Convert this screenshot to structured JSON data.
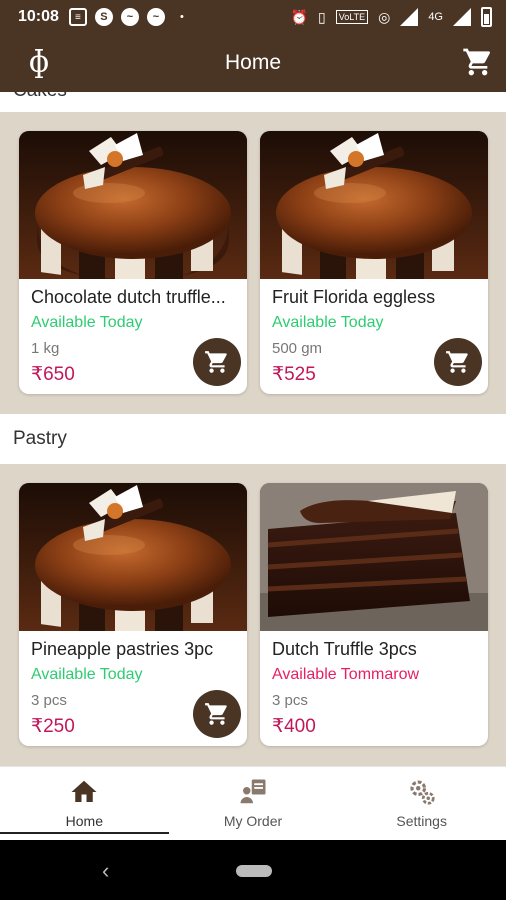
{
  "status_bar": {
    "time": "10:08",
    "network": "4G"
  },
  "app_bar": {
    "title": "Home",
    "logo_text": "ɸ"
  },
  "sections": [
    {
      "title": "Cakes",
      "items": [
        {
          "name": "Chocolate dutch truffle...",
          "availability": "Available Today",
          "quantity": "1 kg",
          "price": "₹650",
          "has_cart": true
        },
        {
          "name": "Fruit Florida eggless",
          "availability": "Available Today",
          "quantity": "500 gm",
          "price": "₹525",
          "has_cart": true
        }
      ]
    },
    {
      "title": "Pastry",
      "items": [
        {
          "name": "Pineapple pastries 3pc",
          "availability": "Available Today",
          "quantity": "3 pcs",
          "price": "₹250",
          "has_cart": true
        },
        {
          "name": "Dutch Truffle 3pcs",
          "availability": "Available Tommarow",
          "quantity": "3 pcs",
          "price": "₹400",
          "has_cart": false
        }
      ]
    }
  ],
  "bottom_nav": [
    {
      "label": "Home",
      "icon": "home-icon",
      "active": true
    },
    {
      "label": "My Order",
      "icon": "order-icon",
      "active": false
    },
    {
      "label": "Settings",
      "icon": "settings-icon",
      "active": false
    }
  ],
  "colors": {
    "brand": "#4a3424",
    "band": "#ddd6c8",
    "available": "#2ecc71",
    "unavailable": "#e91e63",
    "price": "#c2185b"
  }
}
